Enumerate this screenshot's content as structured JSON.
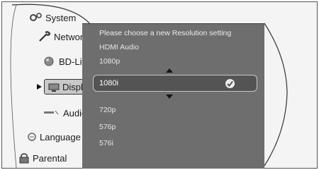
{
  "sidebar": {
    "items": [
      {
        "label": "System",
        "icon": "gears-icon"
      },
      {
        "label": "Network",
        "icon": "wrench-icon"
      },
      {
        "label": "BD-Live",
        "icon": "globe-icon"
      },
      {
        "label": "Display",
        "icon": "monitor-icon"
      },
      {
        "label": "Audio",
        "icon": "speaker-icon"
      },
      {
        "label": "Language",
        "icon": "language-icon"
      },
      {
        "label": "Parental",
        "icon": "lock-icon"
      }
    ]
  },
  "resolution_panel": {
    "prompt": "Please choose a new Resolution setting",
    "options": [
      "HDMI Audio",
      "1080p",
      "1080i",
      "720p",
      "576p",
      "576i"
    ],
    "selected": "1080i"
  },
  "colors": {
    "panel_bg": "#6e6e6e",
    "selected_bg": "#545454",
    "stage_bg": "#f4f4f4"
  }
}
